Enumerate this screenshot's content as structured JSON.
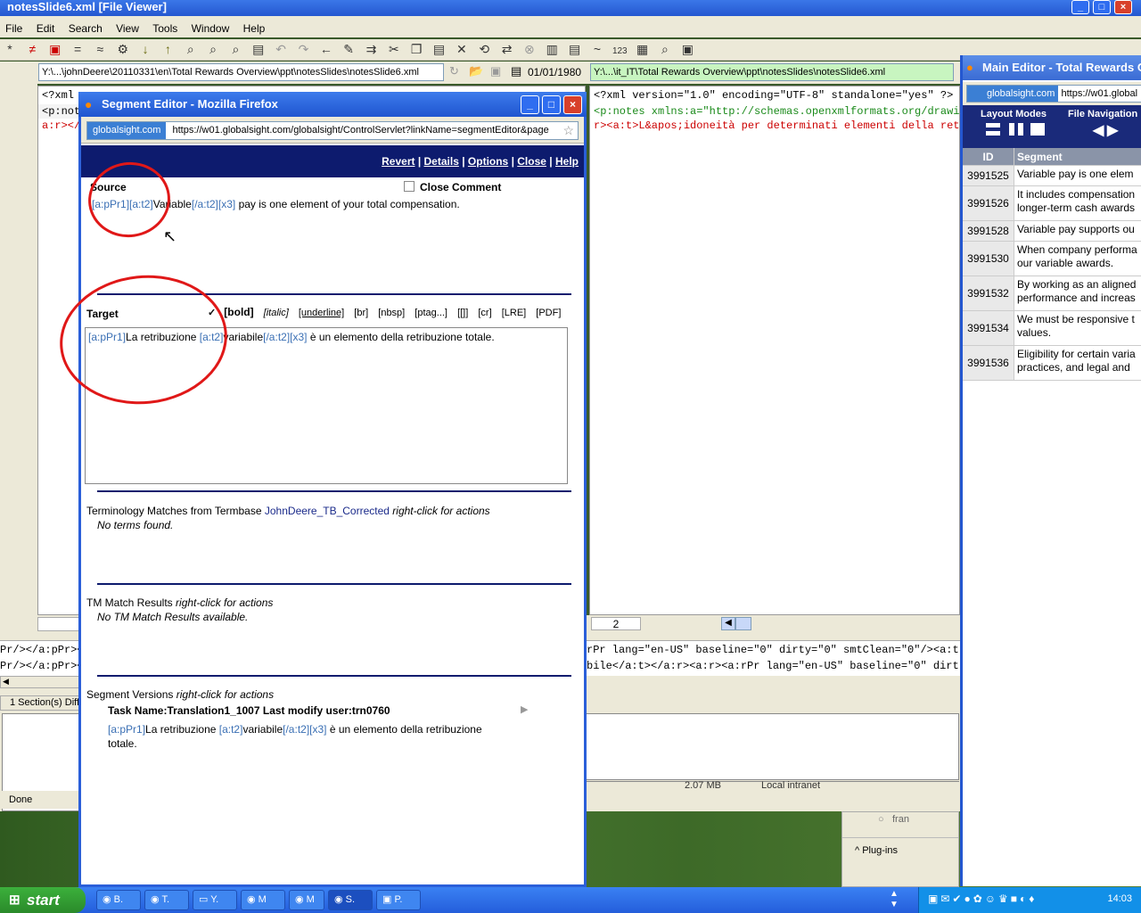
{
  "file_viewer": {
    "title": "notesSlide6.xml  [File Viewer]",
    "menu": [
      "File",
      "Edit",
      "Search",
      "View",
      "Tools",
      "Window",
      "Help"
    ],
    "left_path": "Y:\\...\\johnDeere\\20110331\\en\\Total Rewards Overview\\ppt\\notesSlides\\notesSlide6.xml",
    "left_date": "01/01/1980",
    "right_path": "Y:\\...\\it_IT\\Total Rewards Overview\\ppt\\notesSlides\\notesSlide6.xml",
    "left_code": [
      "<?xml",
      "<p:not",
      "a:r></"
    ],
    "right_code": [
      "<?xml version=\"1.0\" encoding=\"UTF-8\" standalone=\"yes\" ?>",
      "<p:notes xmlns:a=\"http://schemas.openxmlformats.org/drawing",
      "r><a:t>L&apos;idoneità per determinati elementi della retri"
    ],
    "page_number": "2",
    "diff_lines_left": [
      "Pr/></a:pPr><a:",
      "Pr/></a:pPr><a:"
    ],
    "diff_lines_right": [
      "rPr lang=\"en-US\" baseline=\"0\" dirty=\"0\" smtClean=\"0\"/><a:t>",
      "bile</a:t></a:r><a:r><a:rPr lang=\"en-US\" baseline=\"0\" dirty="
    ],
    "sections_status": "1 Section(s) Different",
    "done_label": "Done",
    "ie_status_size": "2.07 MB",
    "ie_status_zone": "Local intranet",
    "plugins_label": "Plug-ins",
    "fran_label": "fran"
  },
  "segment_editor": {
    "title": "Segment Editor - Mozilla Firefox",
    "site_badge": "globalsight.com",
    "url": "https://w01.globalsight.com/globalsight/ControlServlet?linkName=segmentEditor&page",
    "nav": [
      "Revert",
      "Details",
      "Options",
      "Close",
      "Help"
    ],
    "source_label": "Source",
    "close_comment": "Close Comment",
    "source_parts": [
      "[a:pPr1]",
      "[a:t2]",
      "Variable",
      "[/a:t2]",
      "[x3]",
      " pay is one element of your total compensation."
    ],
    "target_label": "Target",
    "format_buttons": [
      "[bold]",
      "[italic]",
      "[underline]",
      "[br]",
      "[nbsp]",
      "[ptag...]",
      "[[]]",
      "[cr]",
      "[LRE]",
      "[PDF]"
    ],
    "target_parts": [
      "[a:pPr1]",
      "La retribuzione ",
      "[a:t2]",
      "variabile",
      "[/a:t2]",
      "[x3]",
      " è un elemento della retribuzione totale."
    ],
    "terminology_title": "Terminology Matches from Termbase",
    "termbase_name": "JohnDeere_TB_Corrected",
    "right_click_hint": "right-click for actions",
    "no_terms": "No terms found.",
    "tm_title": "TM Match Results",
    "no_tm": "No TM Match Results available.",
    "versions_title": "Segment Versions",
    "version_header": "Task Name:Translation1_1007  Last modify user:trn0760",
    "version_parts": [
      "[a:pPr1]",
      "La retribuzione ",
      "[a:t2]",
      "variabile",
      "[/a:t2]",
      "[x3]",
      " è un elemento della retribuzione",
      "totale."
    ]
  },
  "main_editor": {
    "title": "Main Editor - Total Rewards Overview",
    "site_badge": "globalsight.com",
    "url": "https://w01.global",
    "layout_modes": "Layout Modes",
    "file_navigation": "File Navigation",
    "col_id": "ID",
    "col_segment": "Segment",
    "rows": [
      {
        "id": "3991525",
        "lines": [
          "Variable pay is one elem"
        ]
      },
      {
        "id": "3991526",
        "lines": [
          "It includes compensation",
          "longer-term cash awards"
        ]
      },
      {
        "id": "3991528",
        "lines": [
          "Variable pay supports ou"
        ]
      },
      {
        "id": "3991530",
        "lines": [
          "When company performa",
          "our variable awards."
        ]
      },
      {
        "id": "3991532",
        "lines": [
          "By working as an aligned",
          "performance and increas"
        ]
      },
      {
        "id": "3991534",
        "lines": [
          "We must be responsive t",
          "values."
        ]
      },
      {
        "id": "3991536",
        "lines": [
          "Eligibility for certain varia",
          "practices, and legal and"
        ]
      }
    ]
  },
  "taskbar": {
    "start": "start",
    "tasks": [
      "B.",
      "T.",
      "Y.",
      "M",
      "M",
      "S.",
      "P."
    ],
    "clock": "14:03"
  }
}
